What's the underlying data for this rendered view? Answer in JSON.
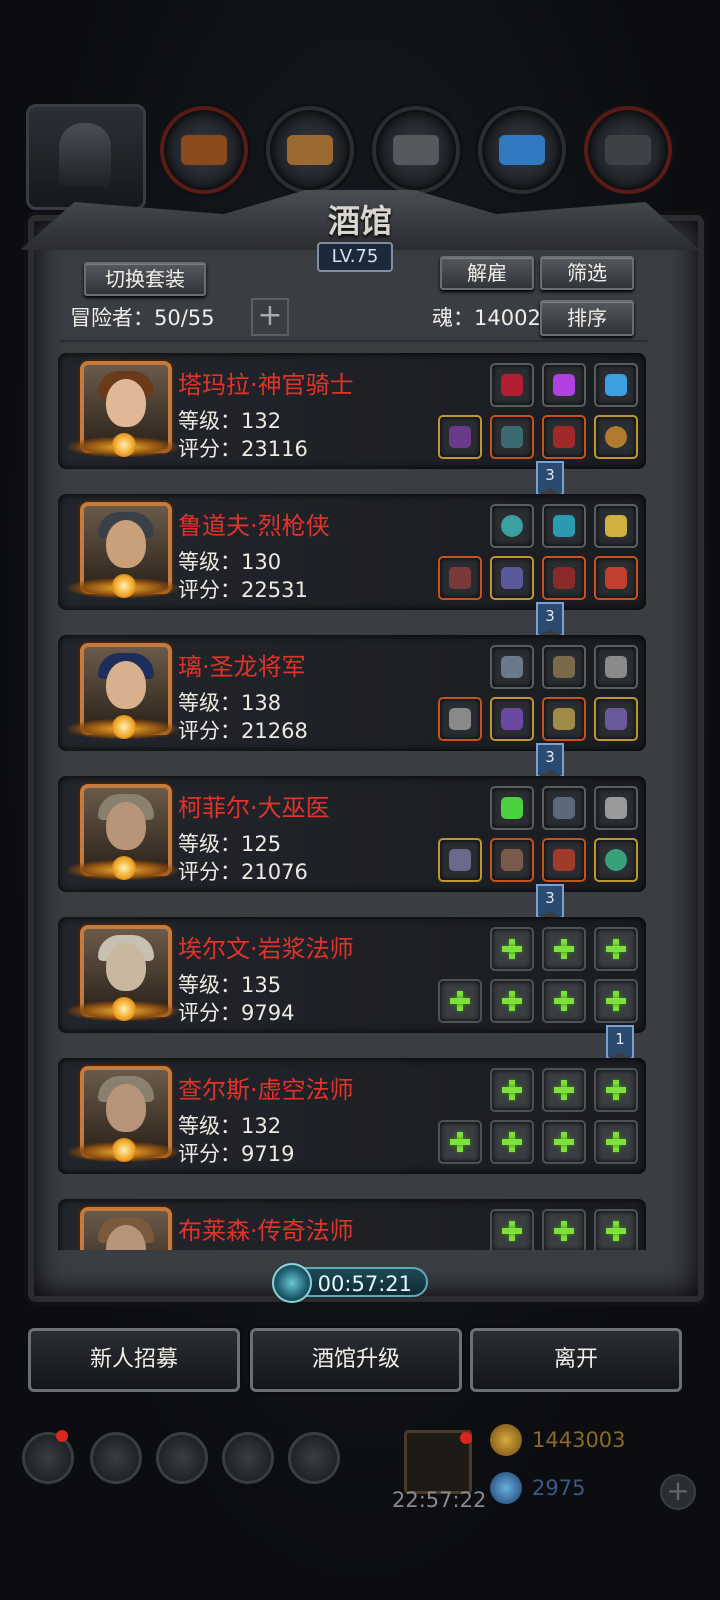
{
  "window": {
    "title": "酒馆",
    "level": "LV.75"
  },
  "toolbar": {
    "switch_outfit": "切换套装",
    "fire": "解雇",
    "filter": "筛选",
    "sort": "排序"
  },
  "stats": {
    "adventurers_label": "冒险者：50/55",
    "soul_label": "魂：14002"
  },
  "heroes": [
    {
      "name": "塔玛拉·神官骑士",
      "level": "等级：132",
      "score": "评分：23116",
      "badge": "3"
    },
    {
      "name": "鲁道夫·烈枪侠",
      "level": "等级：130",
      "score": "评分：22531",
      "badge": "3"
    },
    {
      "name": "璃·圣龙将军",
      "level": "等级：138",
      "score": "评分：21268",
      "badge": "3"
    },
    {
      "name": "柯菲尔·大巫医",
      "level": "等级：125",
      "score": "评分：21076",
      "badge": "3"
    },
    {
      "name": "埃尔文·岩浆法师",
      "level": "等级：135",
      "score": "评分：9794",
      "badge": "1"
    },
    {
      "name": "查尔斯·虚空法师",
      "level": "等级：132",
      "score": "评分：9719",
      "badge": ""
    },
    {
      "name": "布莱森·传奇法师",
      "level": "",
      "score": "",
      "badge": ""
    }
  ],
  "timer": {
    "value": "00:57:21"
  },
  "actions": {
    "recruit": "新人招募",
    "upgrade": "酒馆升级",
    "leave": "离开"
  },
  "bottom": {
    "gift_timer": "22:57:22",
    "gold": "1443003",
    "gems": "2975"
  },
  "colors": {
    "hero_name": "#e0342a",
    "accent_blue": "#7aa2d0",
    "plus_green": "#7ee03a"
  }
}
